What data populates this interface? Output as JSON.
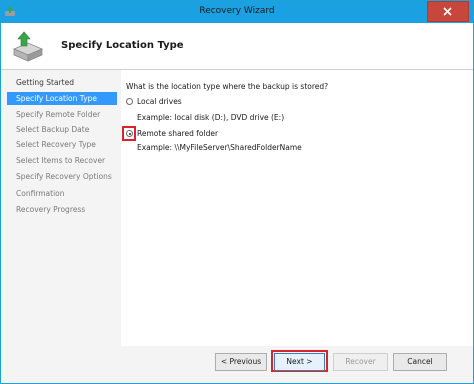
{
  "window": {
    "title": "Recovery Wizard"
  },
  "header": {
    "title": "Specify Location Type"
  },
  "sidebar": {
    "items": [
      {
        "label": "Getting Started"
      },
      {
        "label": "Specify Location Type"
      },
      {
        "label": "Specify Remote Folder"
      },
      {
        "label": "Select Backup Date"
      },
      {
        "label": "Select Recovery Type"
      },
      {
        "label": "Select Items to Recover"
      },
      {
        "label": "Specify Recovery Options"
      },
      {
        "label": "Confirmation"
      },
      {
        "label": "Recovery Progress"
      }
    ],
    "active_index": 1
  },
  "main": {
    "question": "What is the location type where the backup is stored?",
    "options": [
      {
        "label": "Local drives",
        "example": "Example: local disk (D:), DVD drive (E:)",
        "selected": false
      },
      {
        "label": "Remote shared folder",
        "example": "Example: \\\\MyFileServer\\SharedFolderName",
        "selected": true
      }
    ]
  },
  "buttons": {
    "previous": "< Previous",
    "next": "Next >",
    "recover": "Recover",
    "cancel": "Cancel"
  },
  "colors": {
    "titlebar": "#1ba1e2",
    "active_nav": "#3399ff",
    "highlight": "#d9232d",
    "close_button": "#c8473d"
  },
  "icons": {
    "title": "backup-app-icon",
    "header": "server-restore-icon",
    "close": "close-icon"
  }
}
